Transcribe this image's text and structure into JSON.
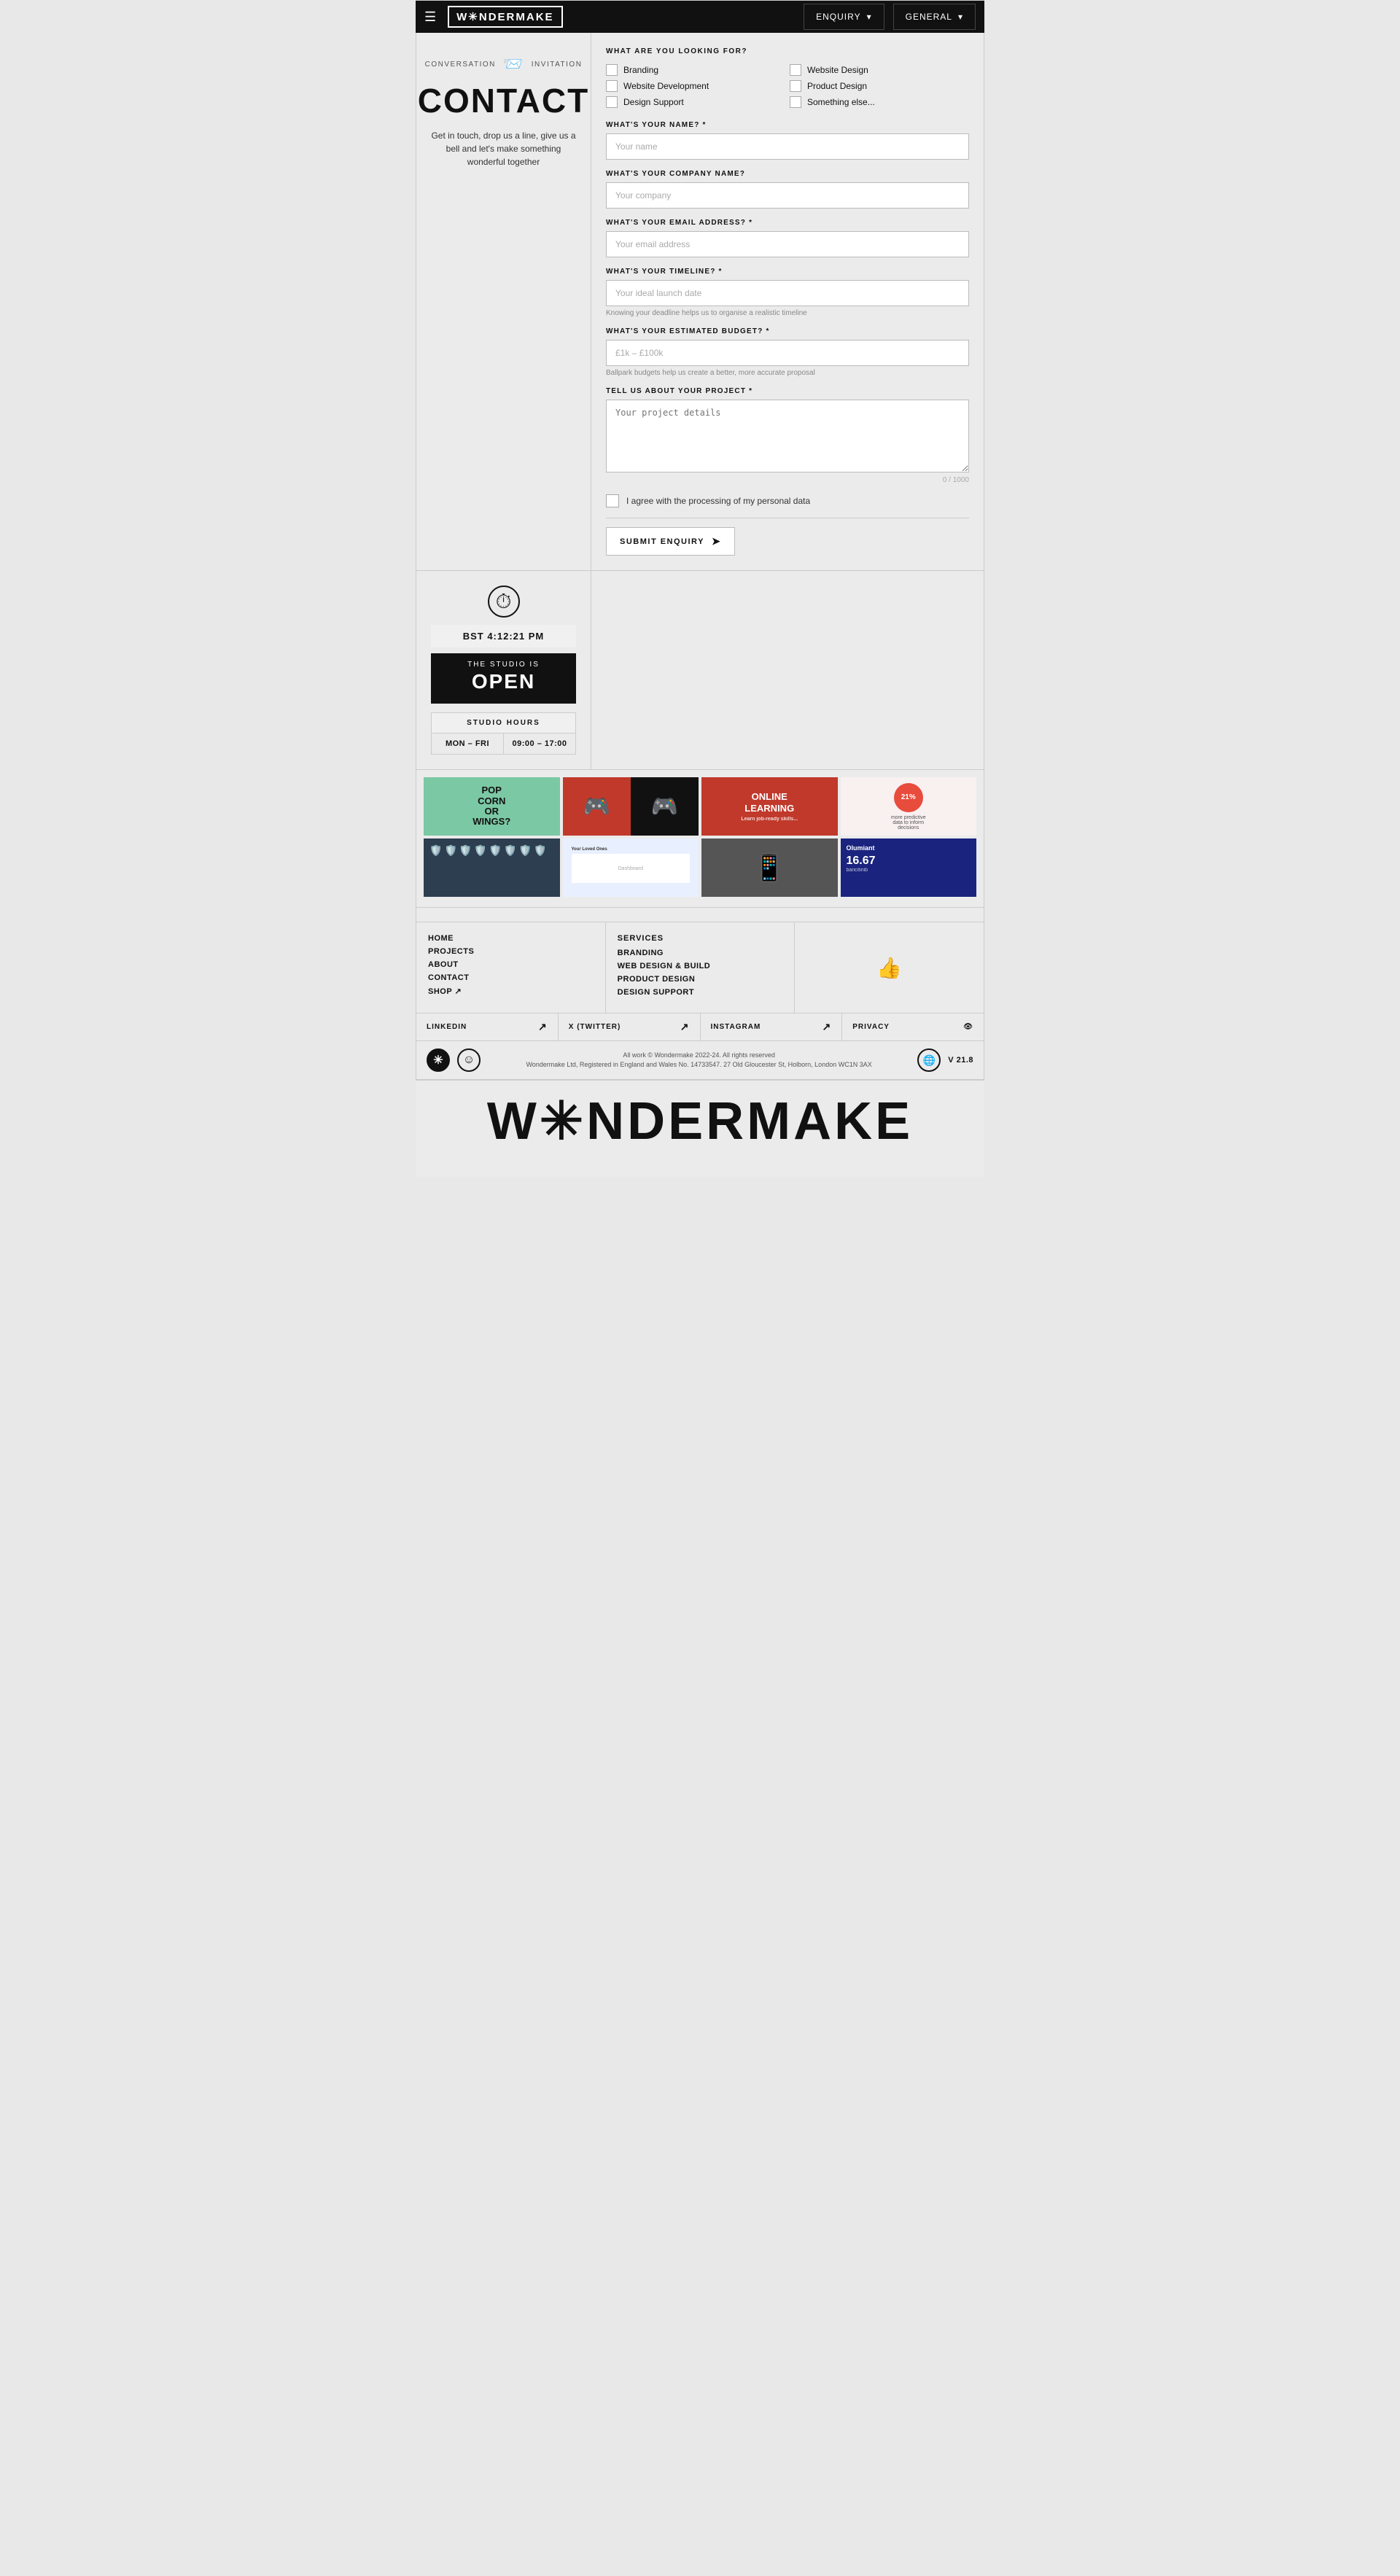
{
  "header": {
    "logo": "W✳NDERMAKE",
    "dropdown1": "ENQUIRY",
    "dropdown2": "GENERAL"
  },
  "contact": {
    "tag1": "CONVERSATION",
    "tag2": "INVITATION",
    "title": "CONTACT",
    "tagline": "Get in touch, drop us a line, give us a bell and\nlet's make something wonderful together"
  },
  "form": {
    "looking_for_label": "WHAT ARE YOU LOOKING FOR?",
    "checkboxes": [
      {
        "label": "Branding",
        "checked": false
      },
      {
        "label": "Website Design",
        "checked": false
      },
      {
        "label": "Website Development",
        "checked": false
      },
      {
        "label": "Product Design",
        "checked": true
      },
      {
        "label": "Design Support",
        "checked": false
      },
      {
        "label": "Something else...",
        "checked": false
      }
    ],
    "name_label": "WHAT'S YOUR NAME? *",
    "name_placeholder": "Your name",
    "company_label": "WHAT'S YOUR COMPANY NAME?",
    "company_placeholder": "Your company",
    "email_label": "WHAT'S YOUR EMAIL ADDRESS? *",
    "email_placeholder": "Your email address",
    "timeline_label": "WHAT'S YOUR TIMELINE? *",
    "timeline_placeholder": "Your ideal launch date",
    "timeline_hint": "Knowing your deadline helps us to organise a realistic timeline",
    "budget_label": "WHAT'S YOUR ESTIMATED BUDGET? *",
    "budget_placeholder": "£1k – £100k",
    "budget_hint": "Ballpark budgets help us create a better, more accurate proposal",
    "project_label": "TELL US ABOUT YOUR PROJECT *",
    "project_placeholder": "Your project details",
    "counter": "0 / 1000",
    "consent_label": "I agree with the processing of my personal data",
    "submit_label": "SUBMIT ENQUIRY"
  },
  "studio": {
    "time": "BST 4:12:21 PM",
    "open_label": "THE STUDIO IS",
    "open_text": "OPEN",
    "hours_title": "STUDIO HOURS",
    "hours_days": "MON – FRI",
    "hours_time": "09:00 – 17:00"
  },
  "footer": {
    "nav_col1": [
      {
        "label": "HOME"
      },
      {
        "label": "PROJECTS"
      },
      {
        "label": "ABOUT"
      },
      {
        "label": "CONTACT"
      },
      {
        "label": "SHOP ↗"
      }
    ],
    "services_title": "SERVICES",
    "nav_col2": [
      {
        "label": "BRANDING"
      },
      {
        "label": "WEB DESIGN & BUILD"
      },
      {
        "label": "PRODUCT DESIGN"
      },
      {
        "label": "DESIGN SUPPORT"
      }
    ],
    "social": [
      {
        "label": "LINKEDIN",
        "arrow": "↗"
      },
      {
        "label": "X (TWITTER)",
        "arrow": "↗"
      },
      {
        "label": "INSTAGRAM",
        "arrow": "↗"
      },
      {
        "label": "PRIVACY",
        "icon": "👁"
      }
    ],
    "copyright_line1": "All work © Wondermake 2022-24. All rights reserved",
    "copyright_line2": "Wondermake Ltd, Registered in England and Wales No. 14733547. 27 Old Gloucester St, Holborn, London WC1N 3AX",
    "version": "V 21.8"
  },
  "big_logo": "W✳NDERMAKE",
  "gallery": {
    "row1": [
      {
        "type": "popcorn",
        "text": "POP\nCORN\nOR\nWINGS?"
      },
      {
        "type": "gamepad"
      },
      {
        "type": "online-learning",
        "text": "ONLINE\nLEARNING"
      },
      {
        "type": "dots-21",
        "percent": "21%"
      }
    ],
    "row2": [
      {
        "type": "shields"
      },
      {
        "type": "dashboard"
      },
      {
        "type": "phone"
      },
      {
        "type": "olumiant",
        "drug": "Olumiant",
        "dose": "16.67"
      }
    ]
  }
}
